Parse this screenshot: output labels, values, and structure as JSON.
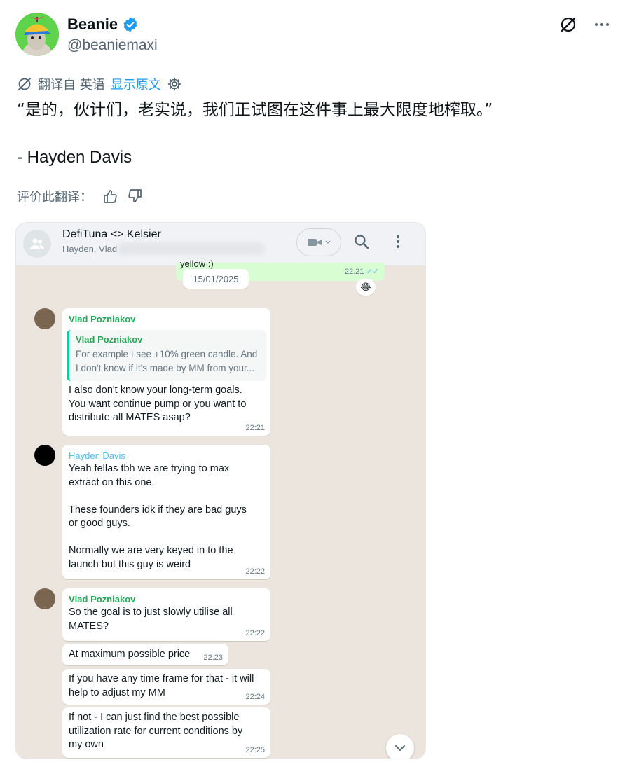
{
  "author": {
    "name": "Beanie",
    "handle": "@beaniemaxi"
  },
  "translation": {
    "translated_from": "翻译自 英语",
    "show_original": "显示原文"
  },
  "tweet": {
    "text": "“是的，伙计们，老实说，我们正试图在这件事上最大限度地榨取。”",
    "signature": "- Hayden Davis"
  },
  "rate": {
    "label": "评价此翻译："
  },
  "colors": {
    "link": "#1d9bf0",
    "whatsapp_green_name": "#1fa855",
    "whatsapp_teal_name": "#53bdeb",
    "outgoing_bubble": "#d9fdd3"
  },
  "chat": {
    "title": "DefiTuna <> Kelsier",
    "participants": "Hayden, Vlad",
    "previous_message": "yellow :)",
    "previous_time": "22:21",
    "previous_reaction": "😂",
    "date_chip": "15/01/2025",
    "messages": [
      {
        "sender": "Vlad Pozniakov",
        "quote_sender": "Vlad Pozniakov",
        "quote_line1": "For example I see +10% green candle. And",
        "quote_line2": "I don't know if it's made by MM from your...",
        "text": "I also don't know your long-term goals.\nYou want continue pump or you want to\ndistribute all MATES asap?",
        "time": "22:21"
      },
      {
        "sender": "Hayden Davis",
        "text": "Yeah fellas tbh we are trying to max\nextract on this one.\n\nThese founders idk if they are bad guys\nor good guys.\n\nNormally we are very keyed in to the\nlaunch but this guy is weird",
        "time": "22:22"
      },
      {
        "sender": "Vlad Pozniakov",
        "text": "So the goal is to just slowly utilise all\nMATES?",
        "time": "22:22"
      },
      {
        "text": "At maximum possible price",
        "time": "22:23"
      },
      {
        "text": "If you have any time frame for that - it will\nhelp to adjust my MM",
        "time": "22:24"
      },
      {
        "text": "If not - I can just find the best possible\nutilization rate for current conditions by\nmy own",
        "time": "22:25"
      }
    ]
  }
}
